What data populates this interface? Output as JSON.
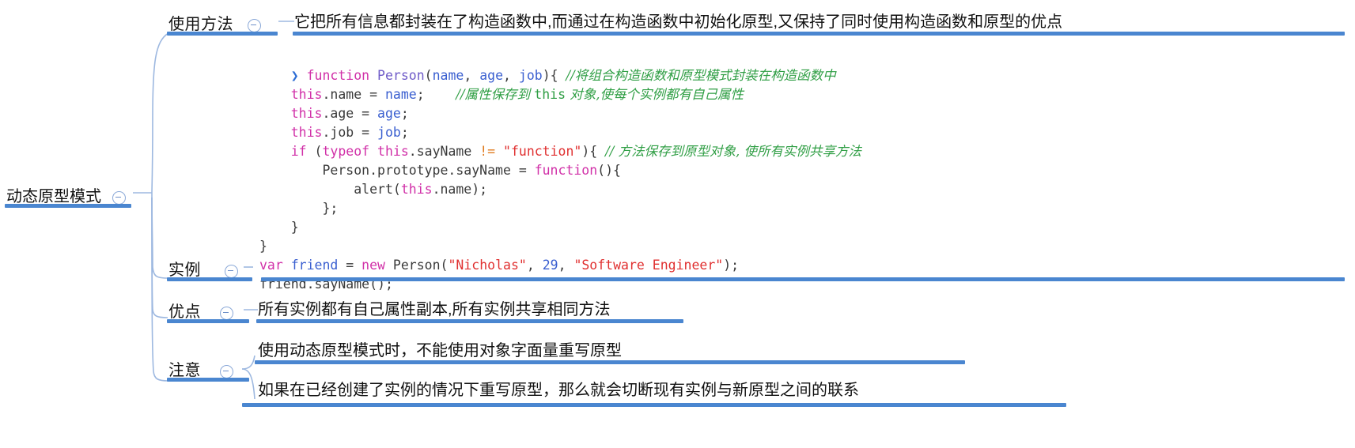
{
  "root": {
    "label": "动态原型模式"
  },
  "branches": [
    {
      "label": "使用方法",
      "leaf": "它把所有信息都封装在了构造函数中,而通过在构造函数中初始化原型,又保持了同时使用构造函数和原型的优点"
    },
    {
      "label": "实例",
      "leaf": ""
    },
    {
      "label": "优点",
      "leaf": "所有实例都有自己属性副本,所有实例共享相同方法"
    },
    {
      "label": "注意",
      "leaf": "使用动态原型模式时，不能使用对象字面量重写原型",
      "leaf2": "如果在已经创建了实例的情况下重写原型，那么就会切断现有实例与新原型之间的联系"
    }
  ],
  "code": {
    "marker": "❯",
    "lines": [
      [
        {
          "t": "function",
          "c": "kw"
        },
        {
          "t": " ",
          "c": "plain"
        },
        {
          "t": "Person",
          "c": "fn"
        },
        {
          "t": "(",
          "c": "plain"
        },
        {
          "t": "name",
          "c": "var"
        },
        {
          "t": ", ",
          "c": "plain"
        },
        {
          "t": "age",
          "c": "var"
        },
        {
          "t": ", ",
          "c": "plain"
        },
        {
          "t": "job",
          "c": "var"
        },
        {
          "t": "){ ",
          "c": "plain"
        },
        {
          "t": "//将组合构造函数和原型模式封装在构造函数中",
          "c": "cmt"
        }
      ],
      [
        {
          "t": "    ",
          "c": "plain"
        },
        {
          "t": "this",
          "c": "kw"
        },
        {
          "t": ".name = ",
          "c": "plain"
        },
        {
          "t": "name",
          "c": "var"
        },
        {
          "t": ";    ",
          "c": "plain"
        },
        {
          "t": "//属性保存到 ",
          "c": "cmt"
        },
        {
          "t": "this",
          "c": "cmt-mono"
        },
        {
          "t": " 对象,使每个实例都有自己属性",
          "c": "cmt"
        }
      ],
      [
        {
          "t": "    ",
          "c": "plain"
        },
        {
          "t": "this",
          "c": "kw"
        },
        {
          "t": ".age = ",
          "c": "plain"
        },
        {
          "t": "age",
          "c": "var"
        },
        {
          "t": ";",
          "c": "plain"
        }
      ],
      [
        {
          "t": "    ",
          "c": "plain"
        },
        {
          "t": "this",
          "c": "kw"
        },
        {
          "t": ".job = ",
          "c": "plain"
        },
        {
          "t": "job",
          "c": "var"
        },
        {
          "t": ";",
          "c": "plain"
        }
      ],
      [
        {
          "t": "    ",
          "c": "plain"
        },
        {
          "t": "if",
          "c": "kw"
        },
        {
          "t": " (",
          "c": "plain"
        },
        {
          "t": "typeof",
          "c": "kw"
        },
        {
          "t": " ",
          "c": "plain"
        },
        {
          "t": "this",
          "c": "kw"
        },
        {
          "t": ".sayName ",
          "c": "plain"
        },
        {
          "t": "!=",
          "c": "op"
        },
        {
          "t": " ",
          "c": "plain"
        },
        {
          "t": "\"function\"",
          "c": "str"
        },
        {
          "t": "){ ",
          "c": "plain"
        },
        {
          "t": "// 方法保存到原型对象, 使所有实例共享方法",
          "c": "cmt"
        }
      ],
      [
        {
          "t": "        Person.prototype.sayName = ",
          "c": "plain"
        },
        {
          "t": "function",
          "c": "kw"
        },
        {
          "t": "(){",
          "c": "plain"
        }
      ],
      [
        {
          "t": "            alert(",
          "c": "plain"
        },
        {
          "t": "this",
          "c": "kw"
        },
        {
          "t": ".name);",
          "c": "plain"
        }
      ],
      [
        {
          "t": "        };",
          "c": "plain"
        }
      ],
      [
        {
          "t": "    }",
          "c": "plain"
        }
      ],
      [
        {
          "t": "}",
          "c": "plain"
        }
      ],
      [
        {
          "t": "var",
          "c": "kw"
        },
        {
          "t": " ",
          "c": "plain"
        },
        {
          "t": "friend",
          "c": "var"
        },
        {
          "t": " = ",
          "c": "plain"
        },
        {
          "t": "new",
          "c": "kw"
        },
        {
          "t": " Person(",
          "c": "plain"
        },
        {
          "t": "\"Nicholas\"",
          "c": "str"
        },
        {
          "t": ", ",
          "c": "plain"
        },
        {
          "t": "29",
          "c": "num"
        },
        {
          "t": ", ",
          "c": "plain"
        },
        {
          "t": "\"Software Engineer\"",
          "c": "str"
        },
        {
          "t": ");",
          "c": "plain"
        }
      ],
      [
        {
          "t": "friend.sayName();",
          "c": "plain"
        }
      ]
    ]
  },
  "colors": {
    "branch_bar": "#4a86d0",
    "wire": "#9db8e0",
    "toggle_border": "#8aa8d8",
    "comment": "#2f9e44",
    "keyword": "#d130a8",
    "string": "#e03030",
    "variable": "#3a5fd0"
  }
}
